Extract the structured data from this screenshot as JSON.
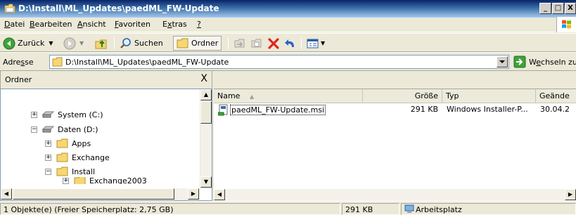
{
  "window": {
    "title": "D:\\Install\\ML_Updates\\paedML_FW-Update",
    "controls": {
      "minimize": "_",
      "maximize": "□",
      "close": "X"
    }
  },
  "menu": {
    "items": [
      {
        "key": "D",
        "rest": "atei"
      },
      {
        "key": "B",
        "rest": "earbeiten"
      },
      {
        "key": "A",
        "rest": "nsicht"
      },
      {
        "key": "F",
        "rest": "avoriten"
      },
      {
        "pre": "E",
        "key": "x",
        "rest": "tras"
      },
      {
        "key": "?",
        "rest": ""
      }
    ]
  },
  "toolbar": {
    "back_label": "Zurück",
    "search_label": "Suchen",
    "folders_label": "Ordner"
  },
  "address": {
    "label_pre": "Adre",
    "label_key": "s",
    "label_post": "se",
    "value": "D:\\Install\\ML_Updates\\paedML_FW-Update",
    "go_label_pre": "W",
    "go_label_key": "e",
    "go_label_post": "chseln zu"
  },
  "folders_pane": {
    "title": "Ordner",
    "close": "X",
    "tree": [
      {
        "label": "System (C:)",
        "sign": "+",
        "level": 1,
        "type": "drive"
      },
      {
        "label": "Daten (D:)",
        "sign": "−",
        "level": 1,
        "type": "drive"
      },
      {
        "label": "Apps",
        "sign": "+",
        "level": 2,
        "type": "folder"
      },
      {
        "label": "Exchange",
        "sign": "+",
        "level": 2,
        "type": "folder"
      },
      {
        "label": "Install",
        "sign": "−",
        "level": 2,
        "type": "folder"
      },
      {
        "label": "Exchange2003",
        "sign": "+",
        "level": 3,
        "type": "folder"
      }
    ]
  },
  "file_list": {
    "columns": [
      "Name",
      "Größe",
      "Typ",
      "Geände"
    ],
    "rows": [
      {
        "name": "paedML_FW-Update.msi",
        "size": "291 KB",
        "type": "Windows Installer-P...",
        "date": "30.04.2"
      }
    ]
  },
  "status": {
    "objects": "1 Objekte(e) (Freier Speicherplatz: 2,75 GB)",
    "size": "291 KB",
    "location": "Arbeitsplatz"
  },
  "colors": {
    "title_start": "#0A246A",
    "title_end": "#A6CAF0",
    "chrome": "#ECE9D8"
  }
}
